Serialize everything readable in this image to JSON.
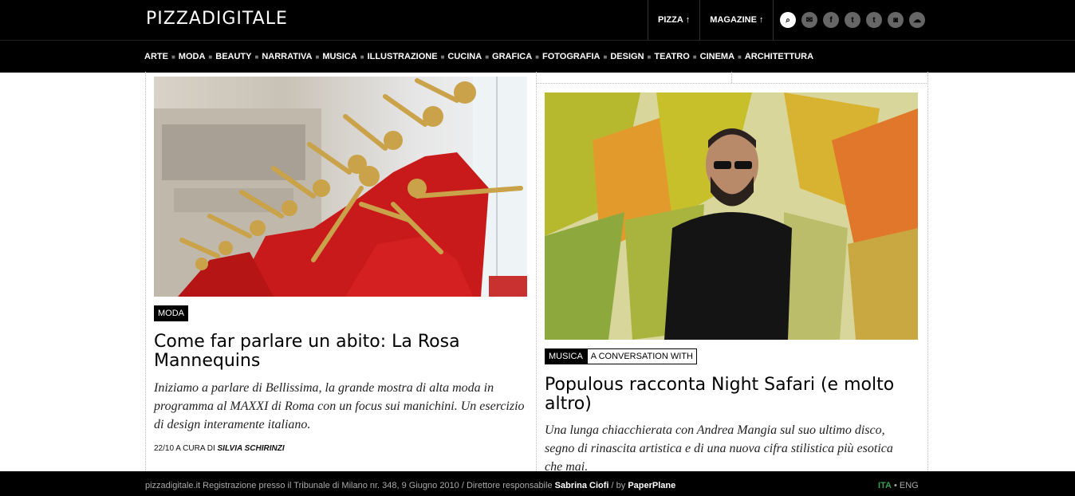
{
  "header": {
    "logo": "PIZZADIGITALE",
    "nav": [
      {
        "label": "PIZZA",
        "arrow": "↑"
      },
      {
        "label": "MAGAZINE",
        "arrow": "↑"
      }
    ],
    "social": [
      {
        "icon": "search-icon",
        "glyph": "⌕"
      },
      {
        "icon": "mail-icon",
        "glyph": "✉"
      },
      {
        "icon": "facebook-icon",
        "glyph": "f"
      },
      {
        "icon": "twitter-icon",
        "glyph": "t"
      },
      {
        "icon": "tumblr-icon",
        "glyph": "t"
      },
      {
        "icon": "instagram-icon",
        "glyph": "◙"
      },
      {
        "icon": "cloud-icon",
        "glyph": "☁"
      }
    ]
  },
  "categories": [
    "ARTE",
    "MODA",
    "BEAUTY",
    "NARRATIVA",
    "MUSICA",
    "ILLUSTRAZIONE",
    "CUCINA",
    "GRAFICA",
    "FOTOGRAFIA",
    "DESIGN",
    "TEATRO",
    "CINEMA",
    "ARCHITETTURA"
  ],
  "article_left": {
    "tag": "MODA",
    "title": "Come far parlare un abito: La Rosa Mannequins",
    "excerpt": "Iniziamo a parlare di Bellissima, la grande mostra di alta moda in programma al MAXXI di Roma con un focus sui manichini. Un esercizio di design interamente italiano.",
    "date": "22/10",
    "curated_label": "A CURA DI",
    "author": "SILVIA SCHIRINZI"
  },
  "article_right": {
    "tag": "MUSICA",
    "subtag": "A CONVERSATION WITH",
    "title": "Populous racconta Night Safari (e molto altro)",
    "excerpt": "Una lunga chiacchierata con Andrea Mangia sul suo ultimo disco, segno di rinascita artistica e di una nuova cifra stilistica più esotica che mai."
  },
  "footer": {
    "text": "pizzadigitale.it Registrazione presso il Tribunale di Milano nr. 348, 9 Giugno 2010 / Direttore responsabile",
    "director": "Sabrina Ciofi",
    "by_label": "/ by",
    "by": "PaperPlane",
    "lang_active": "ITA",
    "lang_sep": "•",
    "lang_other": "ENG"
  },
  "colors": {
    "header_bg": "#000000",
    "lang_active": "#3a9e4a"
  }
}
